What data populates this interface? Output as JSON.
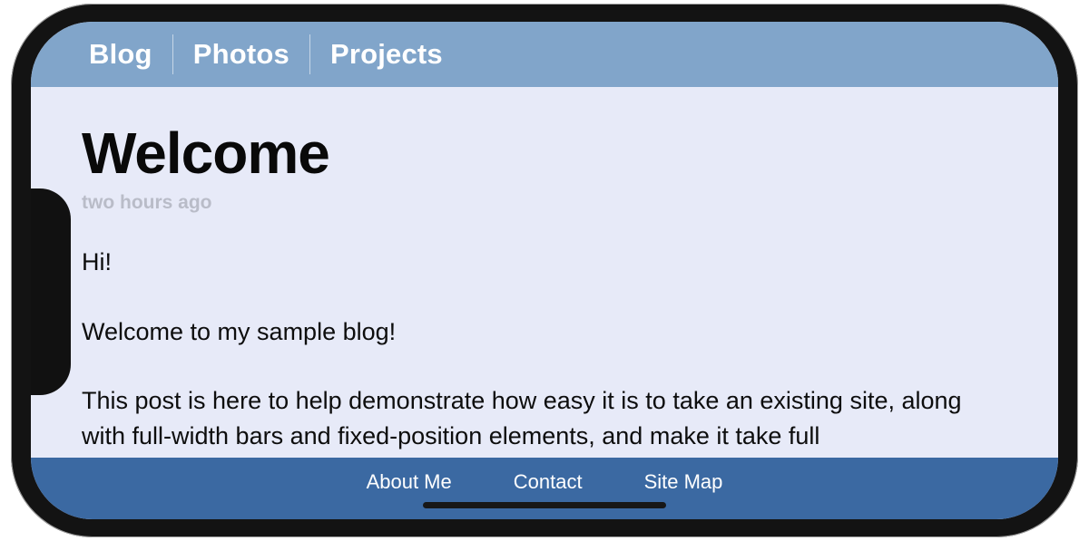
{
  "nav": {
    "items": [
      "Blog",
      "Photos",
      "Projects"
    ]
  },
  "post": {
    "title": "Welcome",
    "time": "two hours ago",
    "body": "Hi!\n\nWelcome to my sample blog!\n\nThis post is here to help demonstrate how easy it is to take an existing site, along with full-width bars and fixed-position elements, and make it take full"
  },
  "footer": {
    "links": [
      "About Me",
      "Contact",
      "Site Map"
    ]
  },
  "colors": {
    "topbar": "#81A5CA",
    "footer": "#3B69A2",
    "page": "#E7EAF8",
    "muted": "#B9BCC8"
  }
}
